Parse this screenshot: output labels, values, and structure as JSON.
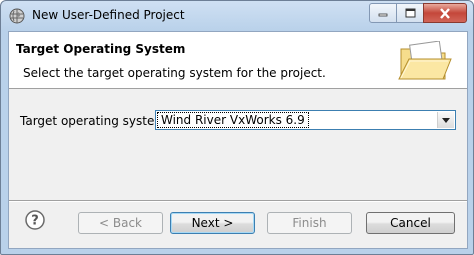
{
  "window": {
    "title": "New User-Defined Project",
    "icons": {
      "app": "app-globe-icon",
      "minimize": "minimize-icon",
      "maximize": "maximize-icon",
      "close": "close-icon"
    }
  },
  "header": {
    "title": "Target Operating System",
    "description": "Select the target operating system for the project.",
    "icon": "folder-open-icon"
  },
  "form": {
    "target_os_label": "Target operating system:",
    "target_os_value": "Wind River VxWorks 6.9",
    "dropdown_icon": "chevron-down-icon"
  },
  "buttons": {
    "back": "< Back",
    "next": "Next >",
    "finish": "Finish",
    "cancel": "Cancel",
    "help_icon": "help-icon"
  },
  "colors": {
    "accent": "#3c7fb1",
    "close": "#c4473a",
    "titlebar": "#b9d1ea"
  }
}
